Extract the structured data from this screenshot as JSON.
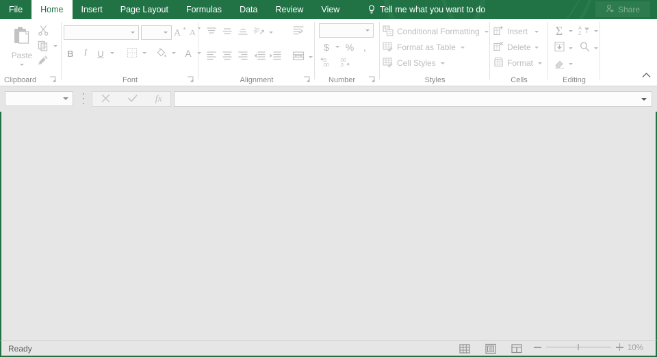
{
  "titlebar": {
    "tabs": [
      {
        "label": "File",
        "active": false
      },
      {
        "label": "Home",
        "active": true
      },
      {
        "label": "Insert",
        "active": false
      },
      {
        "label": "Page Layout",
        "active": false
      },
      {
        "label": "Formulas",
        "active": false
      },
      {
        "label": "Data",
        "active": false
      },
      {
        "label": "Review",
        "active": false
      },
      {
        "label": "View",
        "active": false
      }
    ],
    "tellme": "Tell me what you want to do",
    "share": "Share",
    "accent_color": "#217346"
  },
  "ribbon": {
    "groups": [
      {
        "name": "Clipboard",
        "label": "Clipboard",
        "items": [
          {
            "label": "Paste",
            "icon": "clipboard-icon"
          },
          {
            "label": "Cut",
            "icon": "scissors-icon"
          },
          {
            "label": "Copy",
            "icon": "copy-icon"
          },
          {
            "label": "Format Painter",
            "icon": "paintbrush-icon"
          }
        ]
      },
      {
        "name": "Font",
        "label": "Font",
        "font_name_value": "",
        "font_size_value": "",
        "items": [
          {
            "label": "Increase Font Size",
            "icon": "increase-font-icon"
          },
          {
            "label": "Decrease Font Size",
            "icon": "decrease-font-icon"
          },
          {
            "label": "Bold",
            "icon": "bold-icon"
          },
          {
            "label": "Italic",
            "icon": "italic-icon"
          },
          {
            "label": "Underline",
            "icon": "underline-icon"
          },
          {
            "label": "Borders",
            "icon": "borders-icon"
          },
          {
            "label": "Fill Color",
            "icon": "fill-color-icon"
          },
          {
            "label": "Font Color",
            "icon": "font-color-icon"
          }
        ]
      },
      {
        "name": "Alignment",
        "label": "Alignment",
        "items": [
          {
            "label": "Top Align",
            "icon": "align-top-icon"
          },
          {
            "label": "Middle Align",
            "icon": "align-middle-icon"
          },
          {
            "label": "Bottom Align",
            "icon": "align-bottom-icon"
          },
          {
            "label": "Orientation",
            "icon": "orientation-icon"
          },
          {
            "label": "Align Left",
            "icon": "align-left-icon"
          },
          {
            "label": "Center",
            "icon": "align-center-icon"
          },
          {
            "label": "Align Right",
            "icon": "align-right-icon"
          },
          {
            "label": "Decrease Indent",
            "icon": "decrease-indent-icon"
          },
          {
            "label": "Increase Indent",
            "icon": "increase-indent-icon"
          },
          {
            "label": "Wrap Text",
            "icon": "wrap-text-icon"
          },
          {
            "label": "Merge and Center",
            "icon": "merge-center-icon"
          }
        ]
      },
      {
        "name": "Number",
        "label": "Number",
        "number_format_value": "",
        "items": [
          {
            "label": "Accounting Number Format",
            "icon": "currency-icon"
          },
          {
            "label": "Percent Style",
            "icon": "percent-icon"
          },
          {
            "label": "Comma Style",
            "icon": "comma-icon"
          },
          {
            "label": "Decrease Decimal",
            "icon": "decrease-decimal-icon"
          },
          {
            "label": "Increase Decimal",
            "icon": "increase-decimal-icon"
          }
        ]
      },
      {
        "name": "Styles",
        "label": "Styles",
        "items": [
          {
            "label": "Conditional Formatting",
            "icon": "conditional-formatting-icon"
          },
          {
            "label": "Format as Table",
            "icon": "format-as-table-icon"
          },
          {
            "label": "Cell Styles",
            "icon": "cell-styles-icon"
          }
        ]
      },
      {
        "name": "Cells",
        "label": "Cells",
        "items": [
          {
            "label": "Insert",
            "icon": "insert-cells-icon"
          },
          {
            "label": "Delete",
            "icon": "delete-cells-icon"
          },
          {
            "label": "Format",
            "icon": "format-cells-icon"
          }
        ]
      },
      {
        "name": "Editing",
        "label": "Editing",
        "items": [
          {
            "label": "AutoSum",
            "icon": "sigma-icon"
          },
          {
            "label": "Sort & Filter",
            "icon": "sort-filter-icon"
          },
          {
            "label": "Fill",
            "icon": "fill-down-icon"
          },
          {
            "label": "Find & Select",
            "icon": "magnifier-icon"
          },
          {
            "label": "Clear",
            "icon": "eraser-icon"
          }
        ]
      }
    ],
    "collapse_label": "Collapse the Ribbon"
  },
  "formula_bar": {
    "name_box_value": "",
    "cancel_label": "Cancel",
    "enter_label": "Enter",
    "insert_function_label": "fx",
    "formula_value": "",
    "expand_label": "Expand Formula Bar"
  },
  "status_bar": {
    "message": "Ready",
    "views": [
      {
        "label": "Normal",
        "icon": "normal-view-icon"
      },
      {
        "label": "Page Layout",
        "icon": "page-layout-view-icon"
      },
      {
        "label": "Page Break Preview",
        "icon": "page-break-view-icon"
      }
    ],
    "zoom_out_label": "Zoom Out",
    "zoom_in_label": "Zoom In",
    "zoom_value": "10%"
  }
}
